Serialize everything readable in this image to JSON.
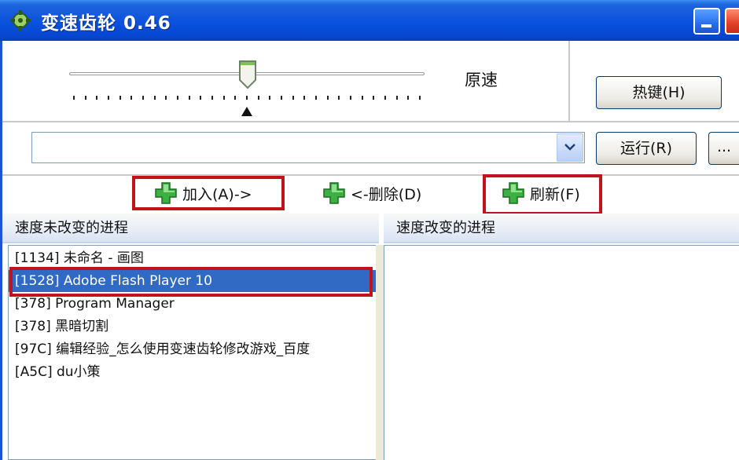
{
  "window": {
    "title": "变速齿轮 0.46"
  },
  "speed": {
    "label": "原速",
    "slider_position": 0.5
  },
  "buttons": {
    "hotkey": "热键(H)",
    "run": "运行(R)",
    "more": "..."
  },
  "combo": {
    "value": ""
  },
  "actions": {
    "add": "加入(A)->",
    "remove": "<-删除(D)",
    "refresh": "刷新(F)"
  },
  "left_list": {
    "header": "速度未改变的进程",
    "items": [
      "[1134]  未命名 - 画图",
      "[1528]  Adobe Flash Player 10",
      "[378]  Program Manager",
      "[378]  黑暗切割",
      "[97C]  编辑经验_怎么使用变速齿轮修改游戏_百度",
      "[A5C]  du小策"
    ],
    "selected_index": 1
  },
  "right_list": {
    "header": "速度改变的进程",
    "items": []
  },
  "colors": {
    "titlebar": "#0a52e0",
    "selection": "#316ac5",
    "highlight_box": "#c0141a",
    "plus_icon": "#2fa02f"
  }
}
